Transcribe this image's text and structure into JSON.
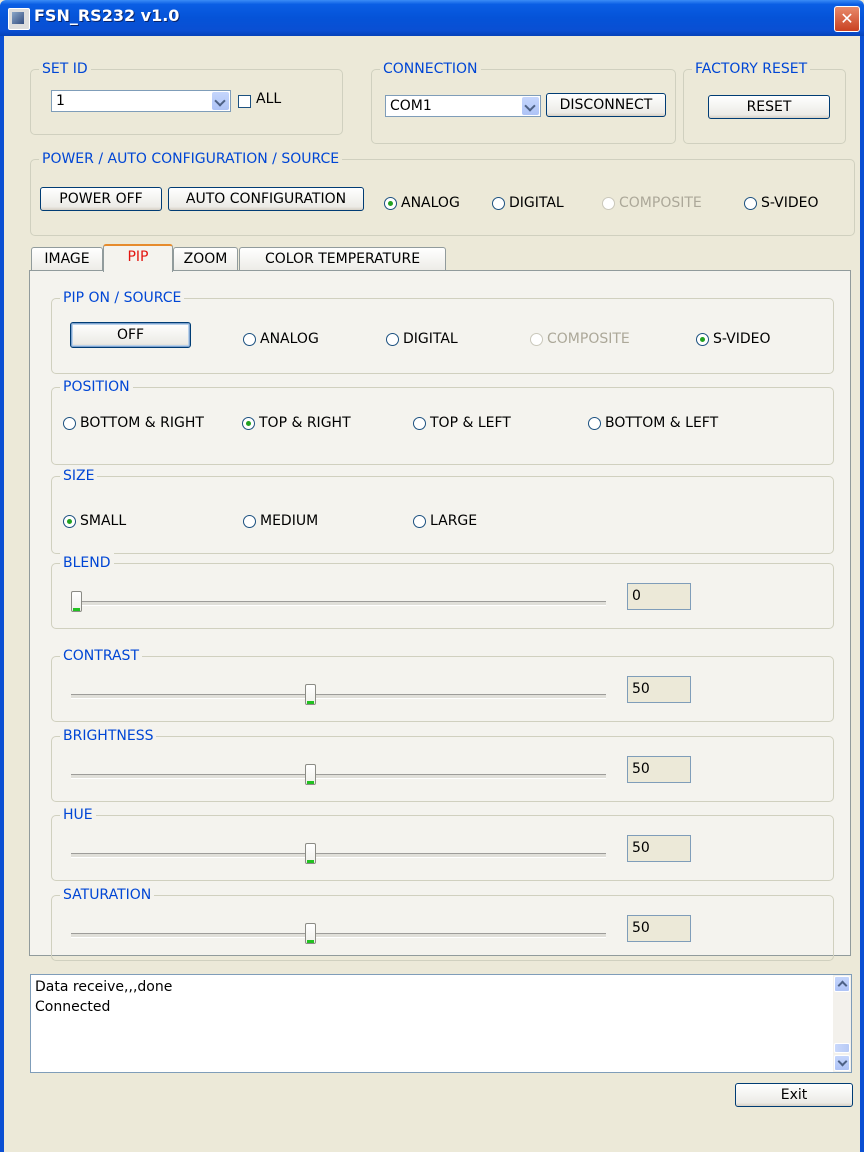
{
  "window": {
    "title": "FSN_RS232 v1.0",
    "close_glyph": "✕"
  },
  "set_id": {
    "label": "SET ID",
    "combo_value": "1",
    "all_label": "ALL"
  },
  "connection": {
    "label": "CONNECTION",
    "combo_value": "COM1",
    "disconnect_label": "DISCONNECT"
  },
  "factory_reset": {
    "label": "FACTORY RESET",
    "reset_label": "RESET"
  },
  "power_group": {
    "label": "POWER / AUTO CONFIGURATION / SOURCE",
    "power_off_label": "POWER OFF",
    "auto_config_label": "AUTO CONFIGURATION",
    "sources": [
      {
        "label": "ANALOG",
        "checked": true
      },
      {
        "label": "DIGITAL",
        "checked": false
      },
      {
        "label": "COMPOSITE",
        "checked": false,
        "disabled": true
      },
      {
        "label": "S-VIDEO",
        "checked": false
      }
    ]
  },
  "tabs": [
    {
      "label": "IMAGE",
      "active": false
    },
    {
      "label": "PIP",
      "active": true
    },
    {
      "label": "ZOOM",
      "active": false
    },
    {
      "label": "COLOR TEMPERATURE",
      "active": false
    }
  ],
  "pip": {
    "source_group": {
      "label": "PIP ON / SOURCE",
      "toggle_label": "OFF",
      "sources": [
        {
          "label": "ANALOG",
          "checked": false
        },
        {
          "label": "DIGITAL",
          "checked": false
        },
        {
          "label": "COMPOSITE",
          "checked": false,
          "disabled": true
        },
        {
          "label": "S-VIDEO",
          "checked": true
        }
      ]
    },
    "position_group": {
      "label": "POSITION",
      "options": [
        {
          "label": "BOTTOM & RIGHT",
          "checked": false
        },
        {
          "label": "TOP & RIGHT",
          "checked": true
        },
        {
          "label": "TOP & LEFT",
          "checked": false
        },
        {
          "label": "BOTTOM & LEFT",
          "checked": false
        }
      ]
    },
    "size_group": {
      "label": "SIZE",
      "options": [
        {
          "label": "SMALL",
          "checked": true
        },
        {
          "label": "MEDIUM",
          "checked": false
        },
        {
          "label": "LARGE",
          "checked": false
        }
      ]
    },
    "sliders": [
      {
        "label": "BLEND",
        "value": "0",
        "level": 0
      },
      {
        "label": "CONTRAST",
        "value": "50",
        "level": 0.5
      },
      {
        "label": "BRIGHTNESS",
        "value": "50",
        "level": 0.5
      },
      {
        "label": "HUE",
        "value": "50",
        "level": 0.5
      },
      {
        "label": "SATURATION",
        "value": "50",
        "level": 0.5
      }
    ]
  },
  "log": {
    "lines": [
      "Data receive,,,done",
      "Connected"
    ]
  },
  "exit_label": "Exit"
}
